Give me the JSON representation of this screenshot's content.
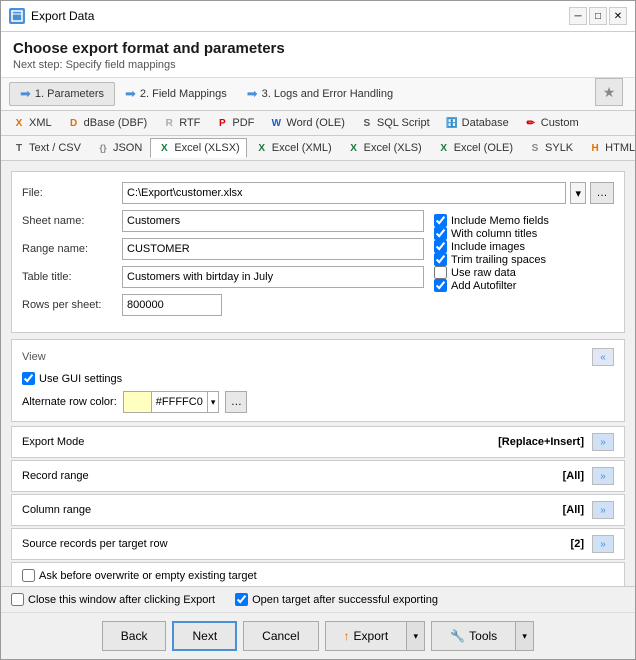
{
  "window": {
    "title": "Export Data",
    "icon": "export-icon"
  },
  "header": {
    "title": "Choose export format and parameters",
    "subtitle": "Next step: Specify field mappings",
    "star_label": "★"
  },
  "steps": [
    {
      "id": "params",
      "label": "1. Parameters",
      "active": true
    },
    {
      "id": "field-mappings",
      "label": "2. Field Mappings",
      "active": false
    },
    {
      "id": "logs",
      "label": "3. Logs and Error Handling",
      "active": false
    }
  ],
  "format_tabs_row1": [
    {
      "id": "xml",
      "label": "XML",
      "icon": "xml-icon"
    },
    {
      "id": "dbase",
      "label": "dBase (DBF)",
      "icon": "dbase-icon"
    },
    {
      "id": "rtf",
      "label": "RTF",
      "icon": "rtf-icon"
    },
    {
      "id": "pdf",
      "label": "PDF",
      "icon": "pdf-icon"
    },
    {
      "id": "word",
      "label": "Word (OLE)",
      "icon": "word-icon"
    },
    {
      "id": "sql",
      "label": "SQL Script",
      "icon": "sql-icon"
    },
    {
      "id": "database",
      "label": "Database",
      "icon": "database-icon"
    },
    {
      "id": "custom",
      "label": "Custom",
      "icon": "custom-icon"
    }
  ],
  "format_tabs_row2": [
    {
      "id": "text",
      "label": "Text / CSV",
      "icon": "text-icon"
    },
    {
      "id": "json",
      "label": "JSON",
      "icon": "json-icon"
    },
    {
      "id": "excel-xlsx",
      "label": "Excel (XLSX)",
      "icon": "excel-icon",
      "active": true
    },
    {
      "id": "excel-xml",
      "label": "Excel (XML)",
      "icon": "excel-icon"
    },
    {
      "id": "excel-xls",
      "label": "Excel (XLS)",
      "icon": "excel-icon"
    },
    {
      "id": "excel-ole",
      "label": "Excel (OLE)",
      "icon": "excel-icon"
    },
    {
      "id": "sylk",
      "label": "SYLK",
      "icon": "sylk-icon"
    },
    {
      "id": "html",
      "label": "HTML",
      "icon": "html-icon"
    }
  ],
  "form": {
    "file_label": "File:",
    "file_value": "C:\\Export\\customer.xlsx",
    "sheet_label": "Sheet name:",
    "sheet_value": "Customers",
    "range_label": "Range name:",
    "range_value": "CUSTOMER",
    "table_label": "Table title:",
    "table_value": "Customers with birtday in July",
    "rows_label": "Rows per sheet:",
    "rows_value": "800000"
  },
  "checkboxes": {
    "include_memo": {
      "label": "Include Memo fields",
      "checked": true
    },
    "with_column_titles": {
      "label": "With column titles",
      "checked": true
    },
    "include_images": {
      "label": "Include images",
      "checked": true
    },
    "trim_trailing": {
      "label": "Trim trailing spaces",
      "checked": true
    },
    "use_raw_data": {
      "label": "Use raw data",
      "checked": false
    },
    "add_autofilter": {
      "label": "Add Autofilter",
      "checked": true
    }
  },
  "view": {
    "title": "View",
    "use_gui_label": "Use GUI settings",
    "use_gui_checked": true,
    "alt_row_label": "Alternate row color:",
    "alt_row_color": "#FFFFC0",
    "alt_row_hex": "#FFFFC0"
  },
  "export_mode": {
    "label": "Export Mode",
    "value": "[Replace+Insert]"
  },
  "record_range": {
    "label": "Record range",
    "value": "[All]"
  },
  "column_range": {
    "label": "Column range",
    "value": "[All]"
  },
  "source_records": {
    "label": "Source records per target row",
    "value": "[2]"
  },
  "ask_overwrite": {
    "label": "Ask before overwrite or empty existing target",
    "checked": false
  },
  "footer": {
    "close_after_label": "Close this window after clicking Export",
    "close_after_checked": false,
    "open_target_label": "Open target after successful exporting",
    "open_target_checked": true
  },
  "buttons": {
    "back": "Back",
    "next": "Next",
    "cancel": "Cancel",
    "export": "Export",
    "tools": "Tools"
  },
  "icons": {
    "chevron_double_left": "«",
    "chevron_right": "»",
    "arrow_right": "→",
    "dropdown_arrow": "▾",
    "chevron_down": "▼"
  }
}
